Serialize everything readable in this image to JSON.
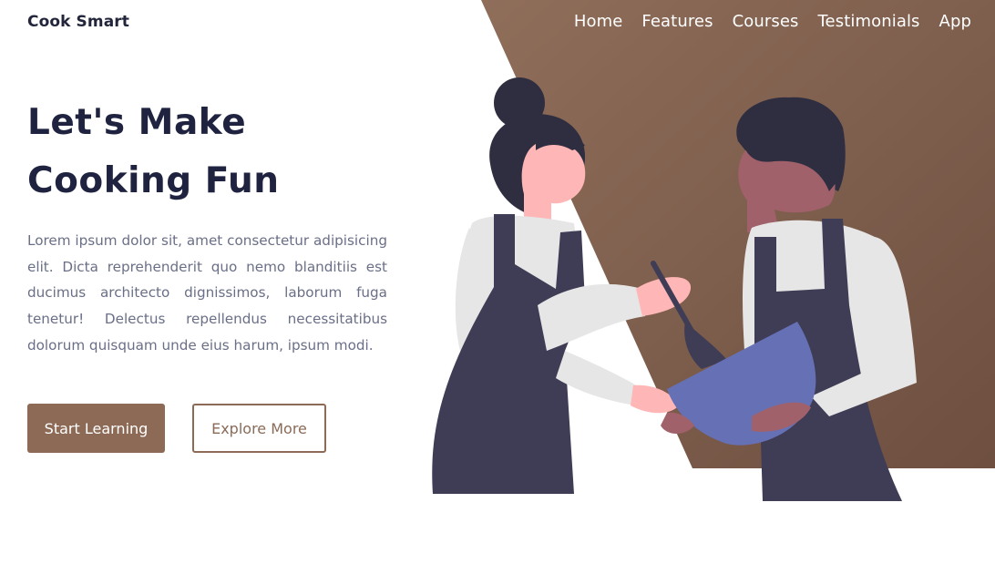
{
  "brand": {
    "name": "Cook Smart"
  },
  "nav": {
    "items": [
      {
        "label": "Home"
      },
      {
        "label": "Features"
      },
      {
        "label": "Courses"
      },
      {
        "label": "Testimonials"
      },
      {
        "label": "App"
      }
    ]
  },
  "hero": {
    "title_line1": "Let's Make",
    "title_line2": "Cooking Fun",
    "description": "Lorem ipsum dolor sit, amet consectetur adipisicing elit. Dicta reprehenderit quo nemo blanditiis est ducimus architecto dignissimos, laborum fuga tenetur! Delectus repellendus necessitatibus dolorum quisquam unde eius harum, ipsum modi.",
    "primary_button": "Start Learning",
    "secondary_button": "Explore More"
  },
  "colors": {
    "accent": "#8c6a55",
    "accent_dark": "#6e4f3f",
    "heading": "#1f2340",
    "body_text": "#6a6f87",
    "apron": "#3f3d56",
    "bowl": "#6670b5"
  },
  "icons": {
    "illustration": "two-chefs-cooking-illustration"
  }
}
